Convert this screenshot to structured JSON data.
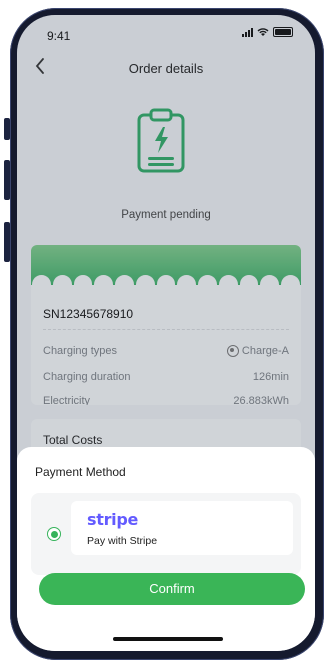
{
  "status_bar": {
    "time": "9:41"
  },
  "nav": {
    "back_icon": "chevron-left-icon",
    "title": "Order details"
  },
  "order": {
    "status": "Payment pending",
    "serial": "SN12345678910",
    "details": [
      {
        "label": "Charging types",
        "value": "Charge-A",
        "icon": "plug-icon"
      },
      {
        "label": "Charging duration",
        "value": "126min"
      },
      {
        "label": "Electricity",
        "value": "26.883kWh"
      }
    ],
    "total_label": "Total Costs"
  },
  "payment_sheet": {
    "title": "Payment Method",
    "method": {
      "brand": "stripe",
      "label": "Pay with Stripe",
      "selected": true
    },
    "confirm_label": "Confirm"
  },
  "colors": {
    "accent": "#3ab557",
    "stripe": "#635bff",
    "frame": "#151a2e"
  }
}
